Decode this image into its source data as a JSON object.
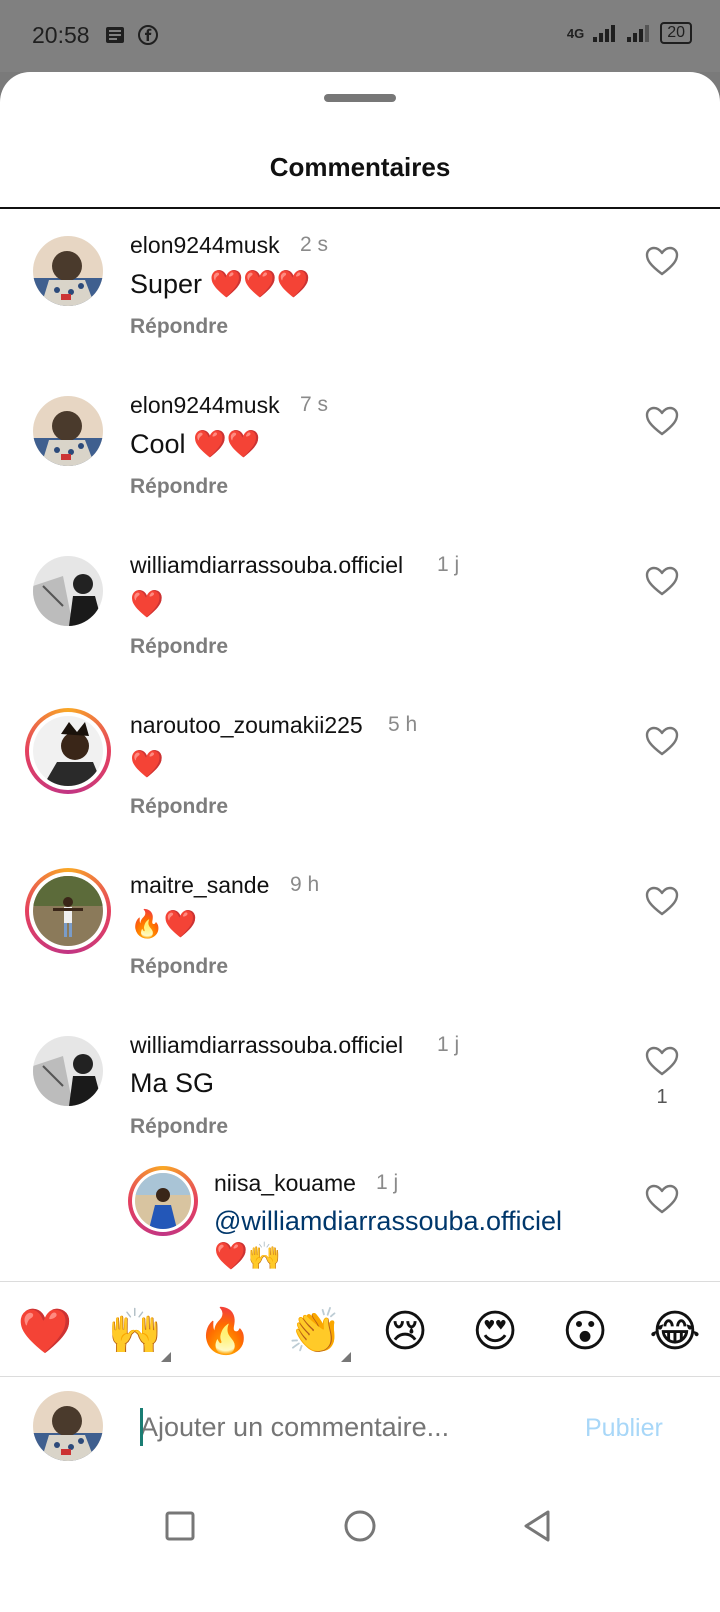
{
  "status_bar": {
    "time": "20:58",
    "network": "4G",
    "battery": "20",
    "left_icons": [
      "news-icon",
      "facebook-icon"
    ]
  },
  "sheet": {
    "title": "Commentaires"
  },
  "comments": [
    {
      "username": "elon9244musk",
      "time": "2 s",
      "text": "Super ❤️❤️❤️",
      "reply": "Répondre",
      "likes": ""
    },
    {
      "username": "elon9244musk",
      "time": "7 s",
      "text": "Cool ❤️❤️",
      "reply": "Répondre",
      "likes": ""
    },
    {
      "username": "williamdiarrassouba.officiel",
      "time": "1 j",
      "text": "❤️",
      "reply": "Répondre",
      "likes": ""
    },
    {
      "username": "naroutoo_zoumakii225",
      "time": "5 h",
      "text": "❤️",
      "reply": "Répondre",
      "likes": ""
    },
    {
      "username": "maitre_sande",
      "time": "9 h",
      "text": "🔥❤️",
      "reply": "Répondre",
      "likes": ""
    },
    {
      "username": "williamdiarrassouba.officiel",
      "time": "1 j",
      "text": "Ma SG",
      "reply": "Répondre",
      "likes": "1"
    }
  ],
  "reply_comment": {
    "username": "niisa_kouame",
    "time": "1 j",
    "mention": "@williamdiarrassouba.officiel",
    "text": "❤️🙌"
  },
  "emoji_bar": [
    "❤️",
    "🙌",
    "🔥",
    "👏",
    "😢",
    "😍",
    "😮",
    "😂"
  ],
  "composer": {
    "placeholder": "Ajouter un commentaire...",
    "publish_label": "Publier"
  },
  "colors": {
    "accent_link": "#00376b",
    "publish_disabled": "#a8d7f8",
    "story_ring": "#e4405f"
  }
}
